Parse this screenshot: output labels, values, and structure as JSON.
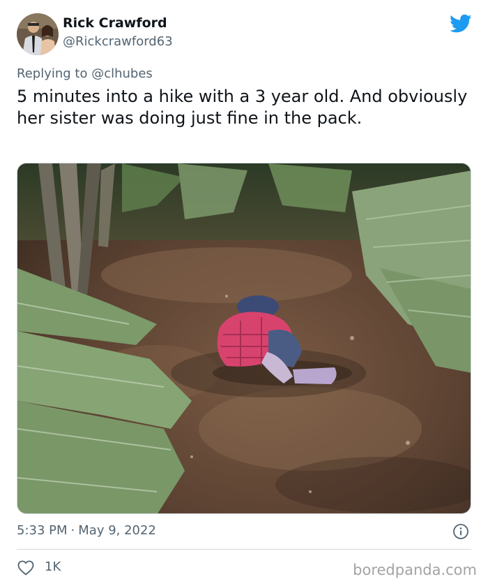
{
  "author": {
    "display_name": "Rick Crawford",
    "handle": "@Rickcrawford63"
  },
  "reply": {
    "prefix": "Replying to ",
    "mention": "@clhubes"
  },
  "tweet": {
    "text": "5 minutes into a hike with a 3 year old. And obviously her sister was doing just fine in the pack."
  },
  "meta": {
    "time": "5:33 PM",
    "separator": "·",
    "date": "May 9, 2022"
  },
  "actions": {
    "like_count": "1K"
  },
  "watermark": "boredpanda.com",
  "colors": {
    "twitter_blue": "#1d9bf0",
    "secondary_text": "#536471",
    "divider": "#cfd9de"
  },
  "icons": {
    "brand": "twitter-bird-icon",
    "info": "info-icon",
    "like": "heart-icon"
  }
}
